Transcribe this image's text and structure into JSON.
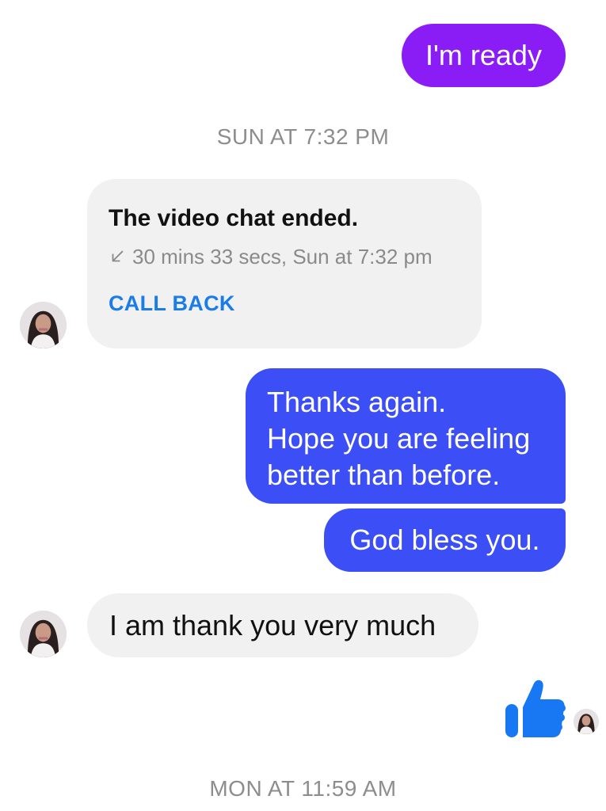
{
  "messages": {
    "out_1": "I'm ready",
    "timestamp_1": "SUN AT 7:32 PM",
    "call_card": {
      "title": "The video chat ended.",
      "detail": "30 mins 33 secs, Sun at 7:32 pm",
      "detail_icon": "incoming-call-arrow-icon",
      "action": "CALL BACK"
    },
    "out_2_lines": [
      "Thanks again.",
      "Hope you are feeling",
      "better than before."
    ],
    "out_3": "God bless you.",
    "in_1": "I am thank you very much",
    "like_icon": "thumbs-up-icon",
    "timestamp_2": "MON AT 11:59 AM"
  },
  "colors": {
    "outgoing_purple": "#8a1cf5",
    "outgoing_blue": "#3c4ef5",
    "incoming_gray": "#f1f1f1",
    "accent_blue": "#1a7ce8",
    "timestamp_gray": "#8d8d8d"
  }
}
